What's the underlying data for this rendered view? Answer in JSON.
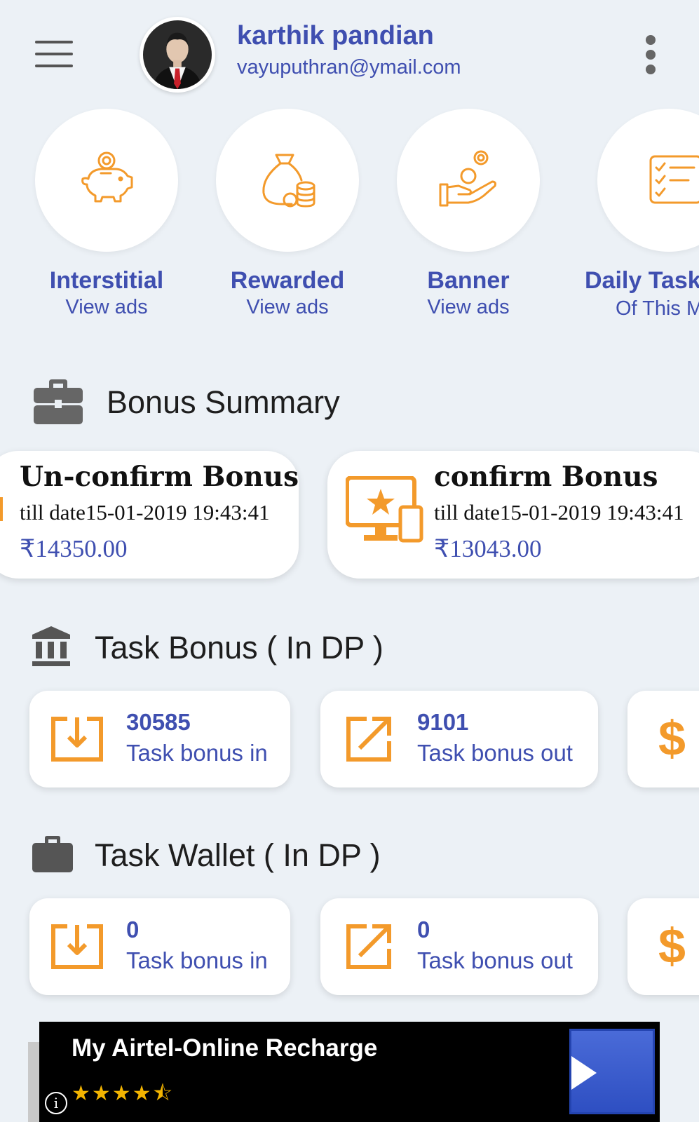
{
  "header": {
    "user_name": "karthik pandian",
    "user_email": "vayuputhran@ymail.com"
  },
  "quick_actions": [
    {
      "title": "Interstitial",
      "subtitle": "View ads",
      "icon": "piggy-bank-icon"
    },
    {
      "title": "Rewarded",
      "subtitle": "View ads",
      "icon": "money-bag-icon"
    },
    {
      "title": "Banner",
      "subtitle": "View ads",
      "icon": "hand-coin-icon"
    },
    {
      "title": "Daily Task",
      "subtitle": "Of This M",
      "icon": "checklist-icon"
    }
  ],
  "bonus_summary": {
    "title": "Bonus Summary",
    "cards": [
      {
        "title": "Un-confirm Bonus",
        "date": "till date15-01-2019 19:43:41",
        "amount": "₹14350.00"
      },
      {
        "title": "confirm Bonus",
        "date": "till date15-01-2019 19:43:41",
        "amount": "₹13043.00"
      }
    ]
  },
  "task_bonus": {
    "title": "Task Bonus ( In DP )",
    "in_value": "30585",
    "in_label": "Task bonus in",
    "out_value": "9101",
    "out_label": "Task bonus out",
    "currency_symbol": "$"
  },
  "task_wallet": {
    "title": "Task Wallet ( In DP )",
    "in_value": "0",
    "in_label": "Task bonus in",
    "out_value": "0",
    "out_label": "Task bonus out",
    "currency_symbol": "$"
  },
  "ad": {
    "title": "My Airtel-Online Recharge",
    "rating_stars": "★★★★⯪",
    "info_glyph": "i"
  },
  "colors": {
    "accent_blue": "#3f4fb0",
    "accent_orange": "#f39a2b",
    "background": "#ecf1f6"
  }
}
